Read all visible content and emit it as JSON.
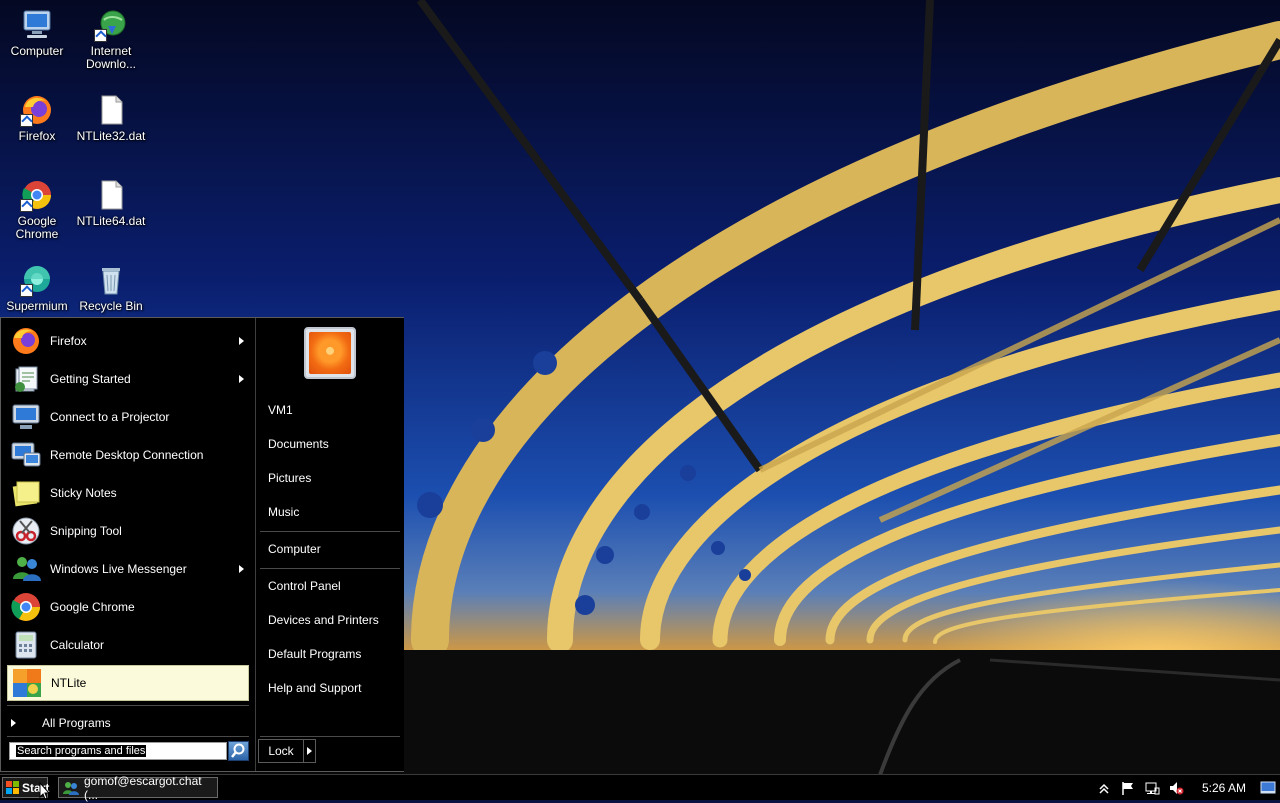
{
  "desktop": {
    "icons": [
      {
        "label": "Computer"
      },
      {
        "label": "Internet Downlo..."
      },
      {
        "label": "Firefox"
      },
      {
        "label": "NTLite32.dat"
      },
      {
        "label": "Google Chrome"
      },
      {
        "label": "NTLite64.dat"
      },
      {
        "label": "Supermium"
      },
      {
        "label": "Recycle Bin"
      }
    ]
  },
  "start_menu": {
    "programs": [
      {
        "label": "Firefox",
        "has_submenu": true,
        "icon": "firefox-icon"
      },
      {
        "label": "Getting Started",
        "has_submenu": true,
        "icon": "getting-started-icon"
      },
      {
        "label": "Connect to a Projector",
        "has_submenu": false,
        "icon": "projector-icon"
      },
      {
        "label": "Remote Desktop Connection",
        "has_submenu": false,
        "icon": "remote-desktop-icon"
      },
      {
        "label": "Sticky Notes",
        "has_submenu": false,
        "icon": "sticky-notes-icon"
      },
      {
        "label": "Snipping Tool",
        "has_submenu": false,
        "icon": "snipping-tool-icon"
      },
      {
        "label": "Windows Live Messenger",
        "has_submenu": true,
        "icon": "messenger-icon"
      },
      {
        "label": "Google Chrome",
        "has_submenu": false,
        "icon": "chrome-icon"
      },
      {
        "label": "Calculator",
        "has_submenu": false,
        "icon": "calculator-icon"
      },
      {
        "label": "NTLite",
        "has_submenu": false,
        "icon": "ntlite-icon",
        "selected": true
      }
    ],
    "all_programs_label": "All Programs",
    "search_placeholder": "Search programs and files",
    "places": [
      "VM1",
      "Documents",
      "Pictures",
      "Music",
      "Computer",
      "Control Panel",
      "Devices and Printers",
      "Default Programs",
      "Help and Support"
    ],
    "lock_label": "Lock"
  },
  "taskbar": {
    "start_label": "Start",
    "task_label": "gomof@escargot.chat (...",
    "clock": "5:26 AM"
  },
  "colors": {
    "sky_top": "#050a2e",
    "sky_mid": "#0f2a8a",
    "horizon": "#d89a3a",
    "selection": "#fbfbdc",
    "menu_bg": "#000000"
  }
}
